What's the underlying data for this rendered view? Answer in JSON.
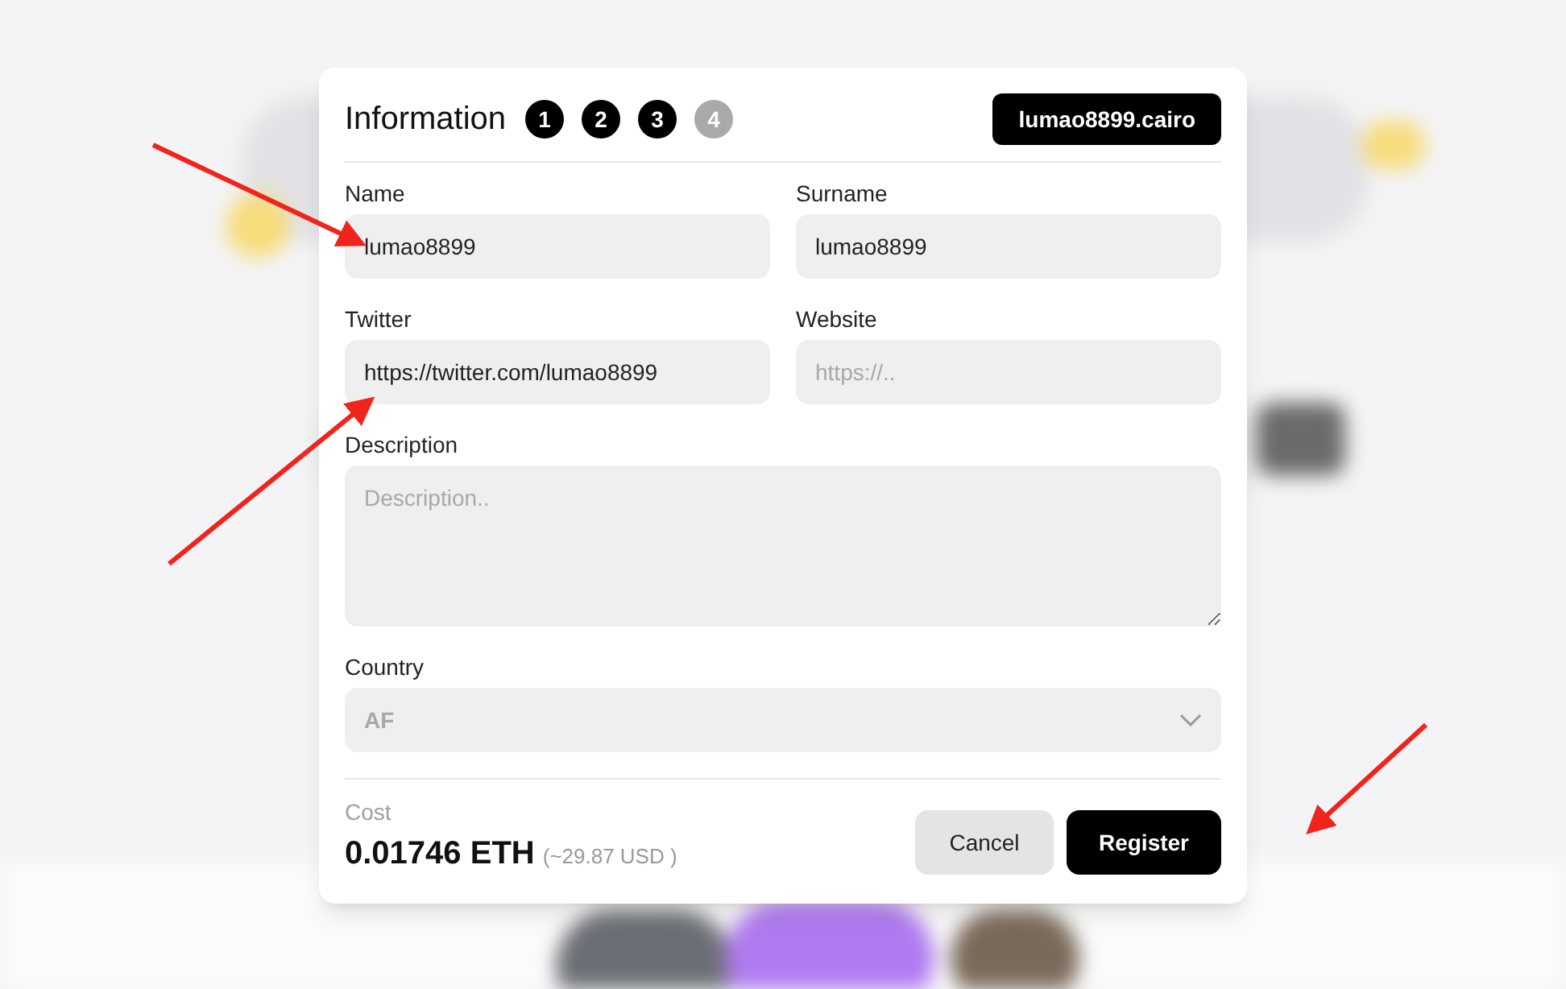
{
  "dialog": {
    "title": "Information",
    "steps": [
      {
        "label": "1",
        "completed": true
      },
      {
        "label": "2",
        "completed": true
      },
      {
        "label": "3",
        "completed": true
      },
      {
        "label": "4",
        "completed": false
      }
    ],
    "domain_badge": "lumao8899.cairo",
    "fields": [
      {
        "kind": "text",
        "label": "Name",
        "value": "lumao8899"
      },
      {
        "kind": "text",
        "label": "Surname",
        "value": "lumao8899"
      },
      {
        "kind": "text",
        "label": "Twitter",
        "value": "https://twitter.com/lumao8899"
      },
      {
        "kind": "text",
        "label": "Website",
        "placeholder": "https://.."
      },
      {
        "kind": "textarea",
        "label": "Description",
        "placeholder": "Description.."
      },
      {
        "kind": "select",
        "label": "Country",
        "value": "AF"
      }
    ],
    "cost": {
      "label": "Cost",
      "amount": "0.01746 ETH",
      "approx": "(~29.87 USD )"
    },
    "buttons": [
      {
        "kind": "secondary",
        "label": "Cancel"
      },
      {
        "kind": "primary",
        "label": "Register"
      }
    ]
  }
}
